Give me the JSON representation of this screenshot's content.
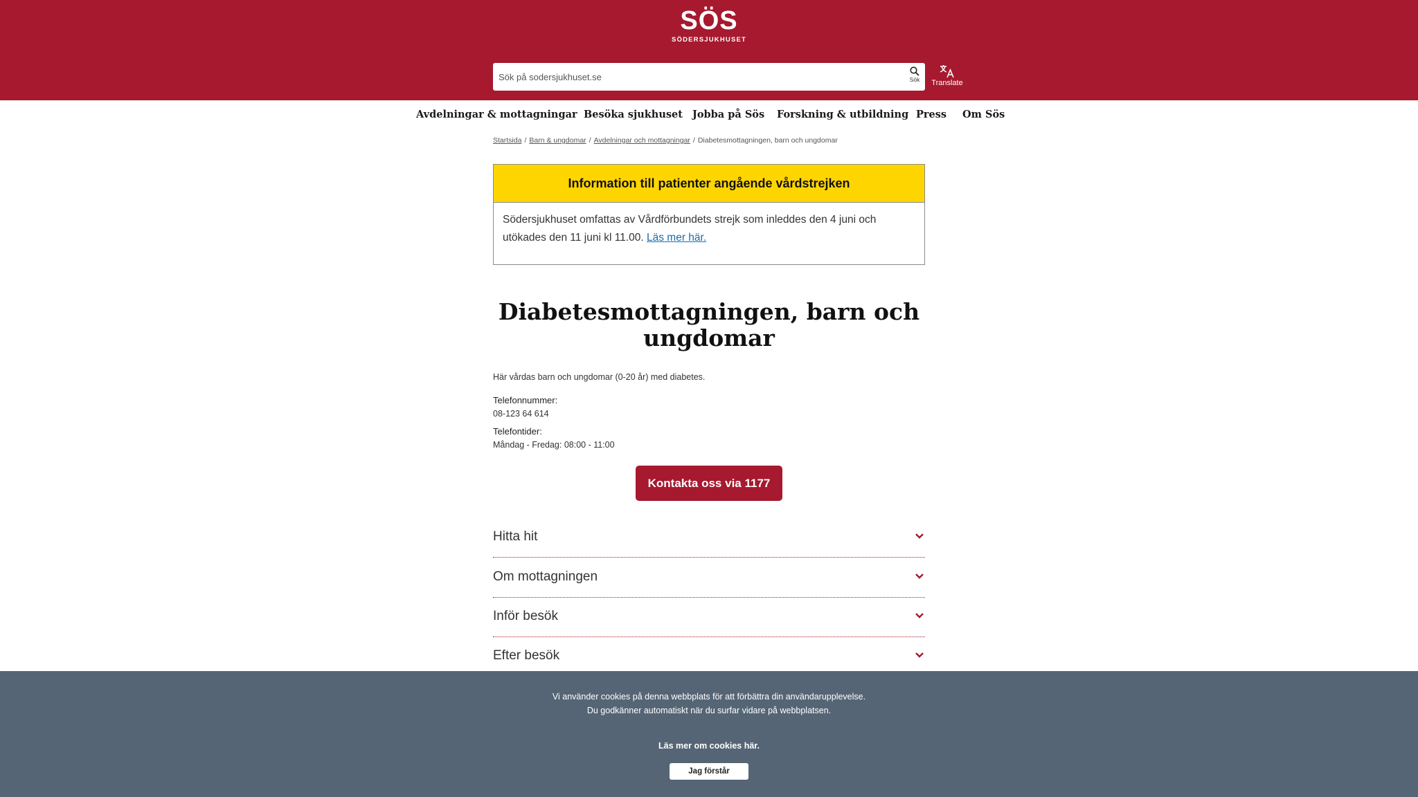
{
  "header": {
    "logo_text": "SÖS",
    "logo_subtitle": "SÖDERSJUKHUSET",
    "search_placeholder": "Sök på sodersjukhuset.se",
    "search_button_label": "Sök",
    "translate_label": "Translate",
    "brand_color": "#a6192e"
  },
  "nav": {
    "items": [
      {
        "label": "Avdelningar & mottagningar"
      },
      {
        "label": "Besöka sjukhuset"
      },
      {
        "label": "Jobba på Sös"
      },
      {
        "label": "Forskning & utbildning"
      },
      {
        "label": "Press"
      },
      {
        "label": "Om Sös"
      }
    ]
  },
  "breadcrumb": {
    "items": [
      "Startsida",
      "Barn & ungdomar",
      "Avdelningar och mottagningar"
    ],
    "current": "Diabetesmottagningen, barn och ungdomar",
    "separator": "/"
  },
  "alert": {
    "title": "Information till patienter angående vårdstrejken",
    "body": "Södersjukhuset omfattas av Vårdförbundets strejk som inleddes den 4 juni och utökades den 11 juni kl 11.00.",
    "link": "Läs mer här.",
    "color": "#ffd500"
  },
  "main": {
    "title": "Diabetesmottagningen, barn och ungdomar",
    "intro": "Här vårdas barn och ungdomar (0-20 år) med diabetes.",
    "phone_label": "Telefonnummer:",
    "phone": "08-123 64 614",
    "times_label": "Telefontider:",
    "times": "Måndag - Fredag: 08:00 - 11:00",
    "contact_button": "Kontakta oss via 1177"
  },
  "accordion": {
    "items": [
      {
        "label": "Hitta hit",
        "icon": "chevron-down-icon"
      },
      {
        "label": "Om mottagningen",
        "icon": "chevron-down-icon"
      },
      {
        "label": "Inför besök",
        "icon": "chevron-down-icon"
      },
      {
        "label": "Efter besök",
        "icon": "chevron-down-icon"
      }
    ]
  },
  "cookie": {
    "text": "Vi använder cookies på denna webbplats för att förbättra din användarupplevelse. Du godkänner automatiskt när du surfar vidare på webbplatsen.",
    "more_link": "Läs mer om cookies här.",
    "accept_button": "Jag förstår",
    "color": "#556575"
  }
}
